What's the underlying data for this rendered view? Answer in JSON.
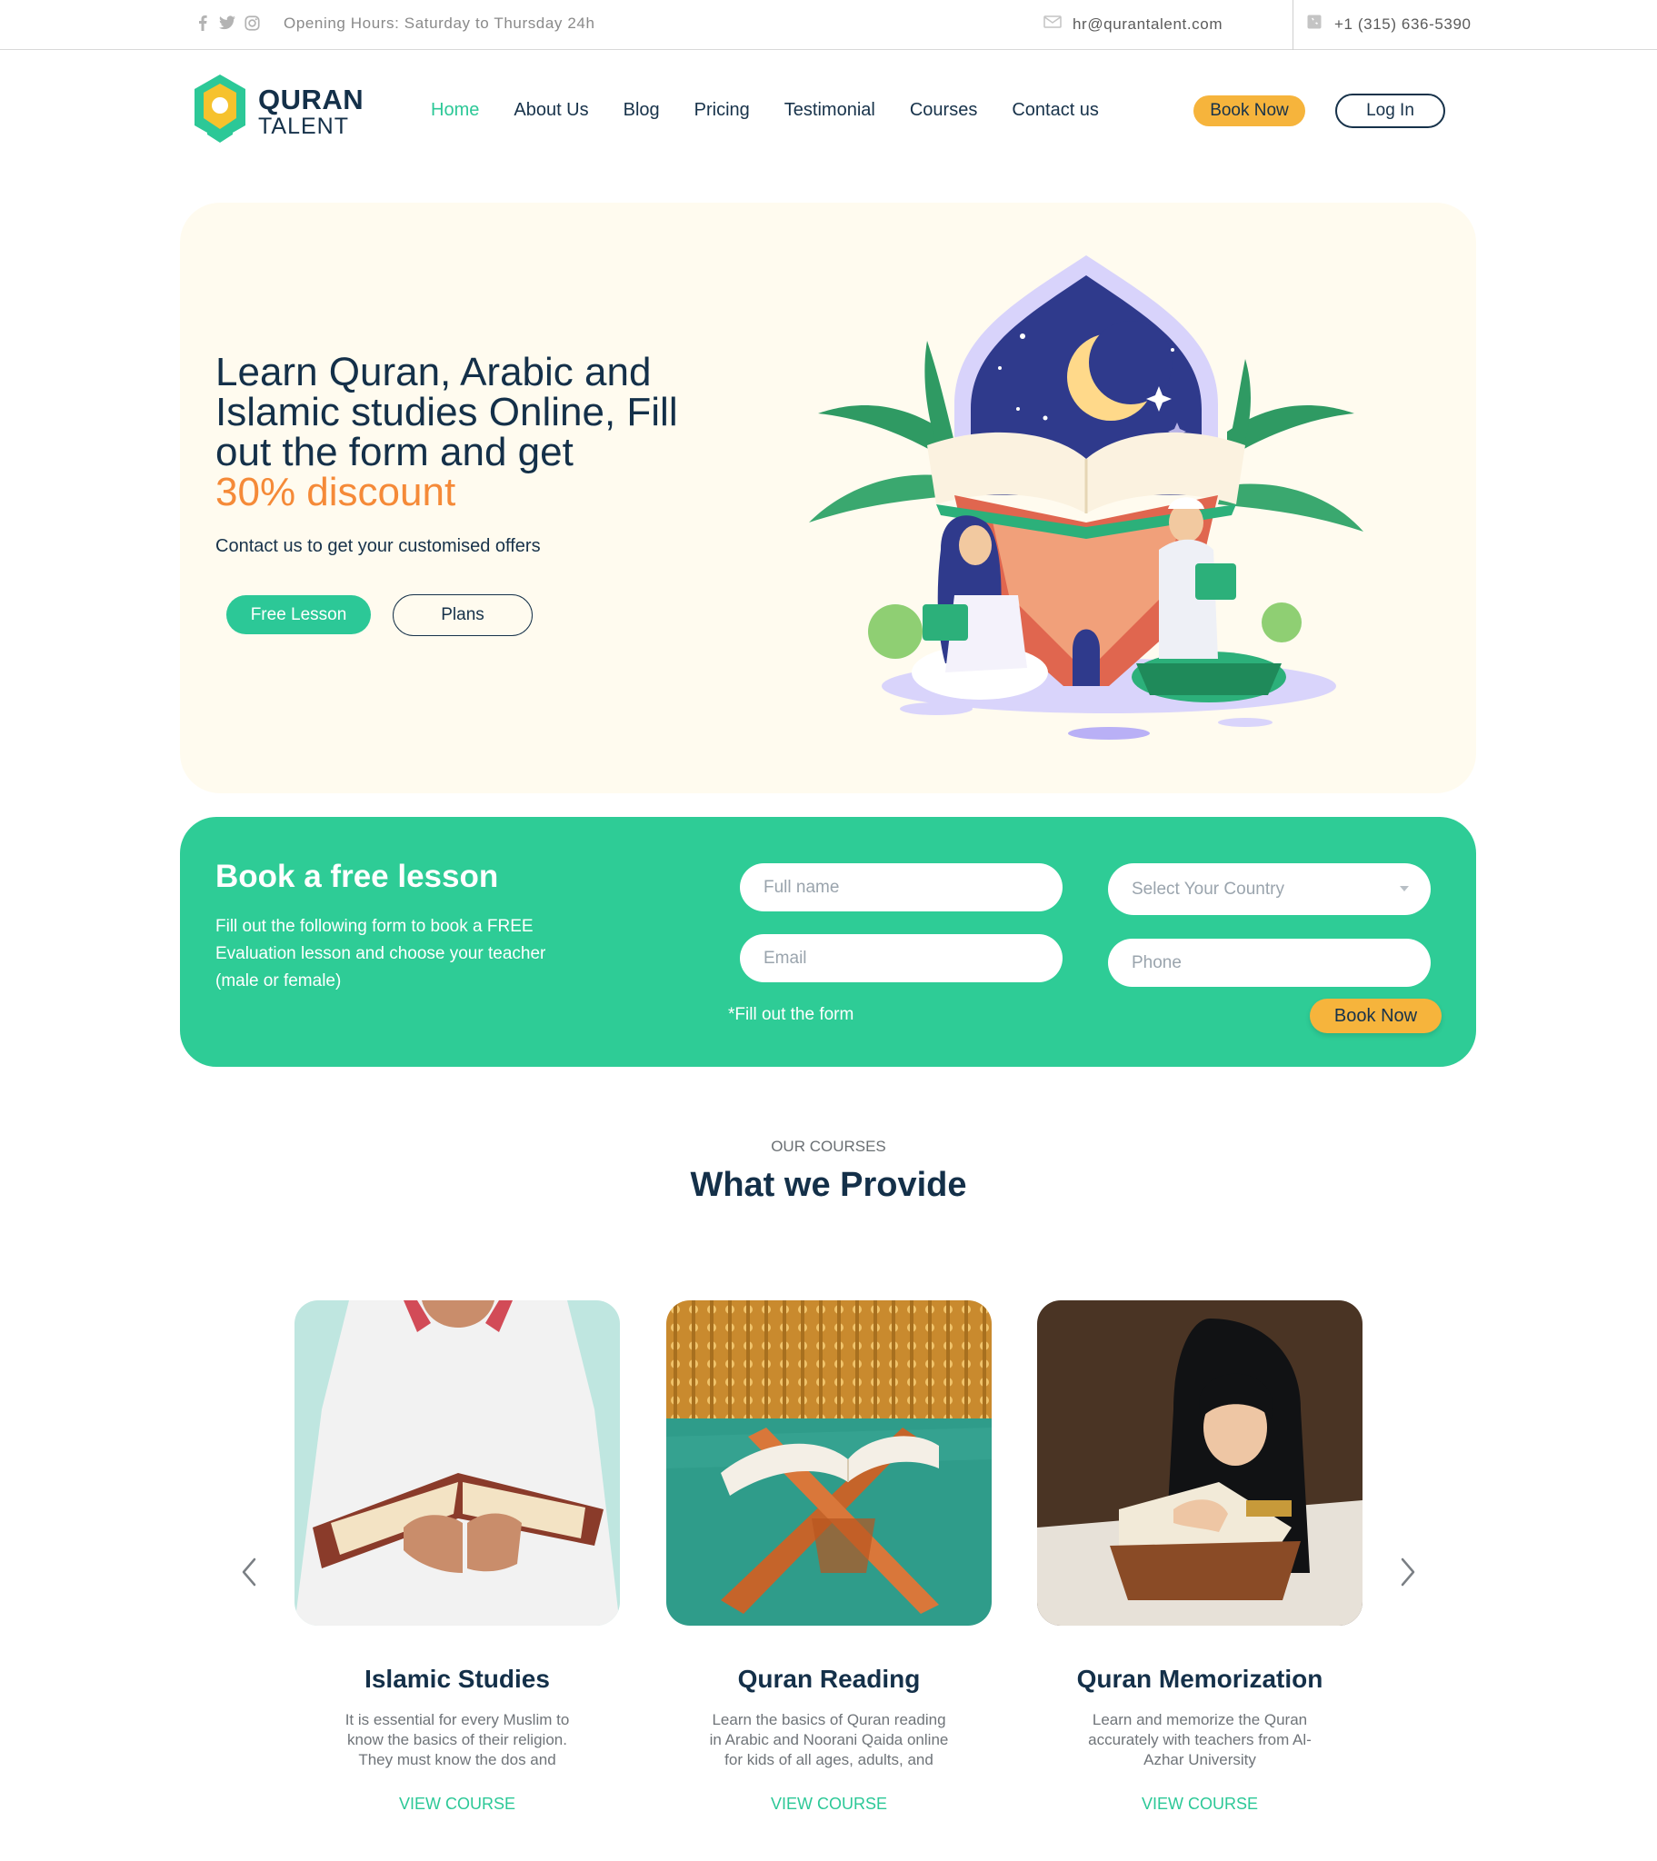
{
  "topbar": {
    "hours": "Opening Hours: Saturday to Thursday 24h",
    "email": "hr@qurantalent.com",
    "phone": "+1 (315) 636-5390",
    "social_icons": [
      "facebook-icon",
      "twitter-icon",
      "instagram-icon"
    ]
  },
  "brand": {
    "line1": "QURAN",
    "line2": "TALENT"
  },
  "nav": {
    "items": [
      "Home",
      "About Us",
      "Blog",
      "Pricing",
      "Testimonial",
      "Courses",
      "Contact us"
    ],
    "active": "Home"
  },
  "header_buttons": {
    "book": "Book Now",
    "login": "Log In"
  },
  "hero": {
    "title": "Learn Quran, Arabic and Islamic studies Online, Fill out the form and get",
    "accent": "30% discount",
    "subtitle": "Contact us to get your customised offers",
    "btn_primary": "Free Lesson",
    "btn_secondary": "Plans"
  },
  "booking": {
    "title": "Book a free lesson",
    "description": "Fill out the following form to book a FREE Evaluation lesson and choose your teacher (male or female)",
    "name_placeholder": "Full name",
    "email_placeholder": "Email",
    "country_placeholder": "Select Your Country",
    "phone_placeholder": "Phone",
    "note": "*Fill out the form",
    "submit": "Book Now"
  },
  "courses": {
    "eyebrow": "OUR COURSES",
    "title": "What we Provide",
    "items": [
      {
        "title": "Islamic Studies",
        "desc": "It is essential for every Muslim to know the basics of their religion. They must know the dos and",
        "link": "VIEW COURSE"
      },
      {
        "title": "Quran Reading",
        "desc": "Learn the basics of Quran reading in Arabic and Noorani Qaida online for kids of all ages, adults, and women.",
        "link": "VIEW COURSE"
      },
      {
        "title": "Quran Memorization",
        "desc": "Learn and memorize the Quran accurately with teachers from Al-Azhar University",
        "link": "VIEW COURSE"
      }
    ]
  },
  "colors": {
    "primary_green": "#2cc897",
    "accent_orange": "#f58a38",
    "button_yellow": "#f6b43c",
    "navy": "#143049",
    "hero_bg": "#fffbef"
  }
}
